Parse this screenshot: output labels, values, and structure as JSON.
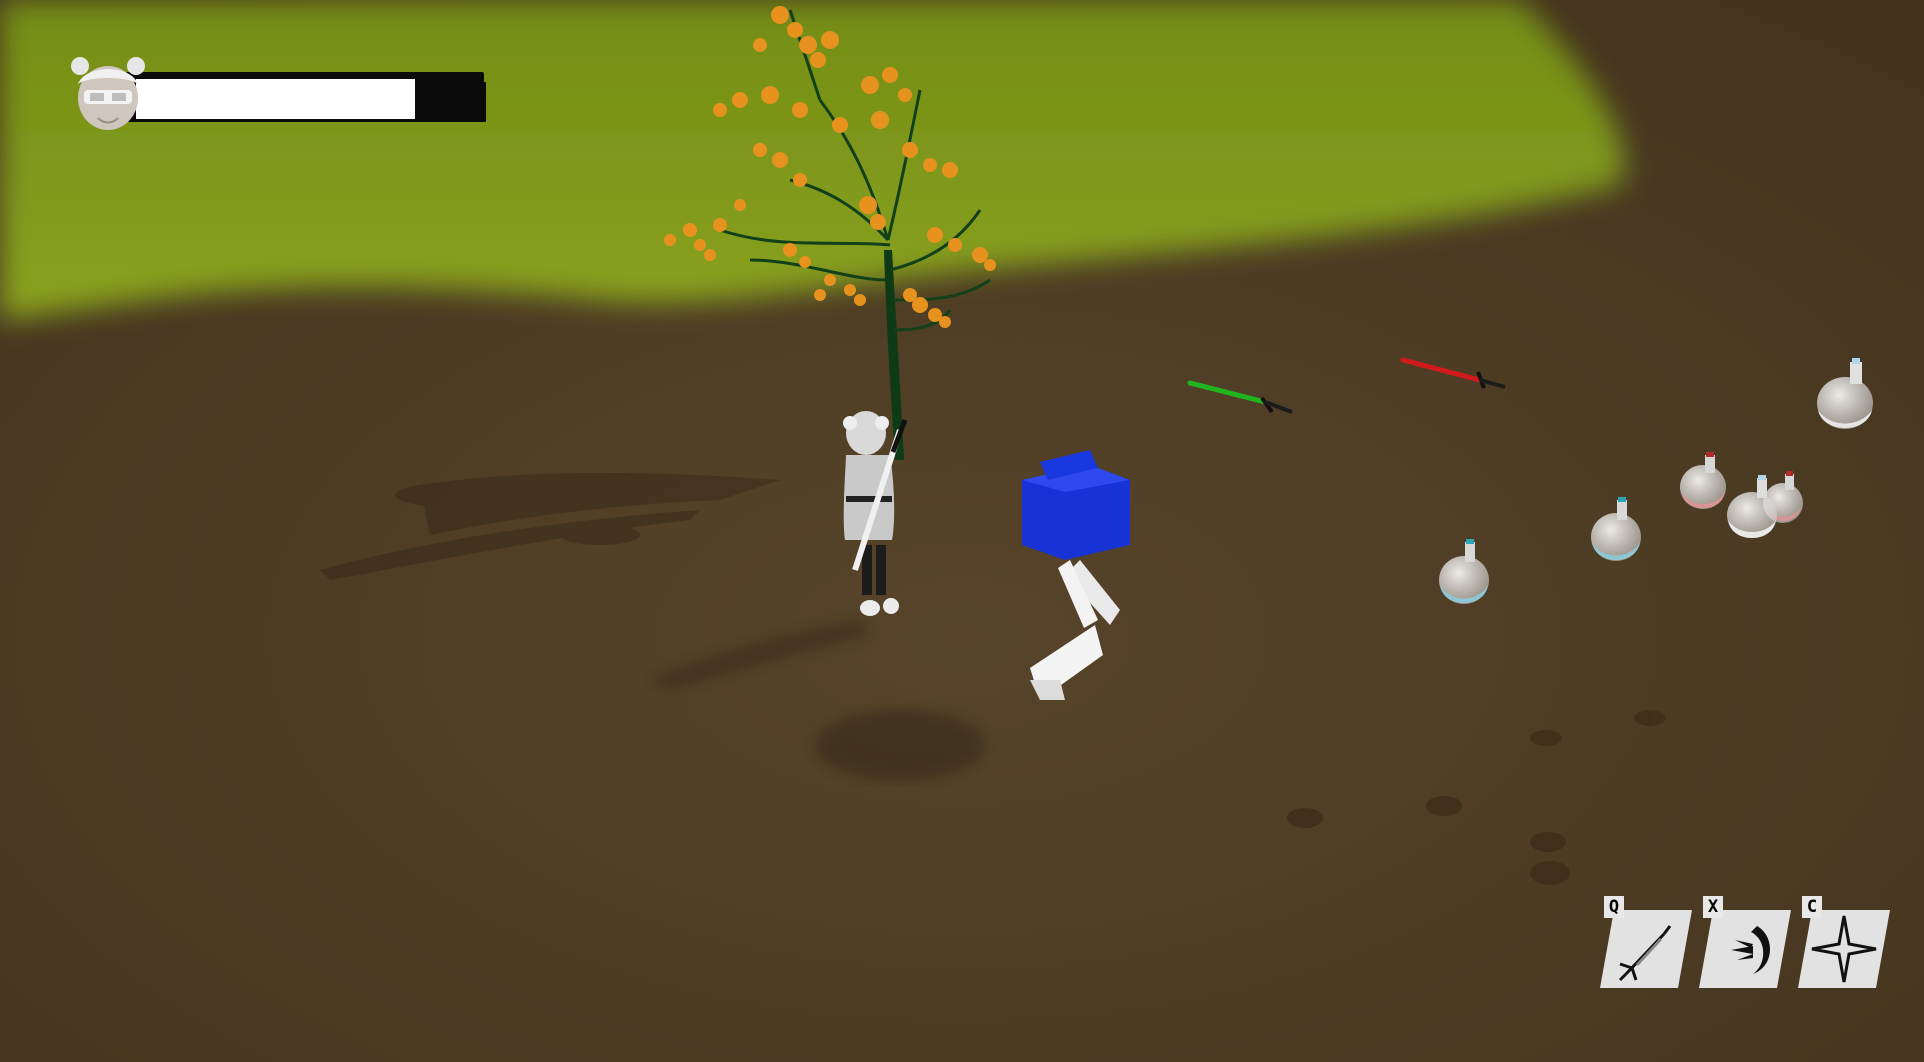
{
  "hud": {
    "health": {
      "fraction": 0.84
    },
    "skills": [
      {
        "key": "Q",
        "icon": "sword-icon"
      },
      {
        "key": "X",
        "icon": "crescent-slash-icon"
      },
      {
        "key": "C",
        "icon": "four-point-star-icon"
      }
    ]
  },
  "colors": {
    "grass": "#7f9a1c",
    "ground": "#4a3a22",
    "tree_leaves": "#e7921f",
    "enemy_cube": "#1a35d4",
    "green_sword": "#1fb51f",
    "red_sword": "#d11a1a",
    "potion_blue": "#8fc6d6",
    "potion_red": "#d99595",
    "potion_white": "#e6e6e6"
  }
}
